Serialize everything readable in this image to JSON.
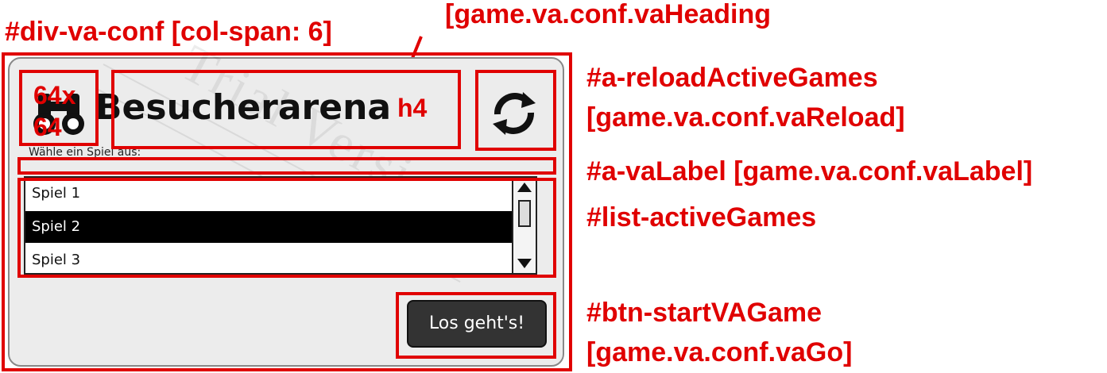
{
  "annotations": {
    "div_va_conf": "#div-va-conf [col-span: 6]",
    "va_heading": "[game.va.conf.vaHeading",
    "reload_id": "#a-reloadActiveGames",
    "reload_key": "[game.va.conf.vaReload]",
    "label_line": "#a-vaLabel [game.va.conf.vaLabel]",
    "list_id": "#list-activeGames",
    "btn_id": "#btn-startVAGame",
    "btn_key": "[game.va.conf.vaGo]",
    "icon_size_1": "64x",
    "icon_size_2": "64",
    "heading_tag": "h4"
  },
  "mockup": {
    "heading": "Besucherarena",
    "label": "Wähle ein Spiel aus:",
    "games": [
      "Spiel 1",
      "Spiel 2",
      "Spiel 3"
    ],
    "selected_index": 1,
    "go_button": "Los geht's!",
    "watermark": "Trial Version",
    "icons": {
      "heading_icon": "binoculars-icon",
      "reload_icon": "refresh-icon"
    }
  },
  "colors": {
    "annotation": "#e00000",
    "selected_row": "#000000",
    "button_bg": "#333333"
  }
}
